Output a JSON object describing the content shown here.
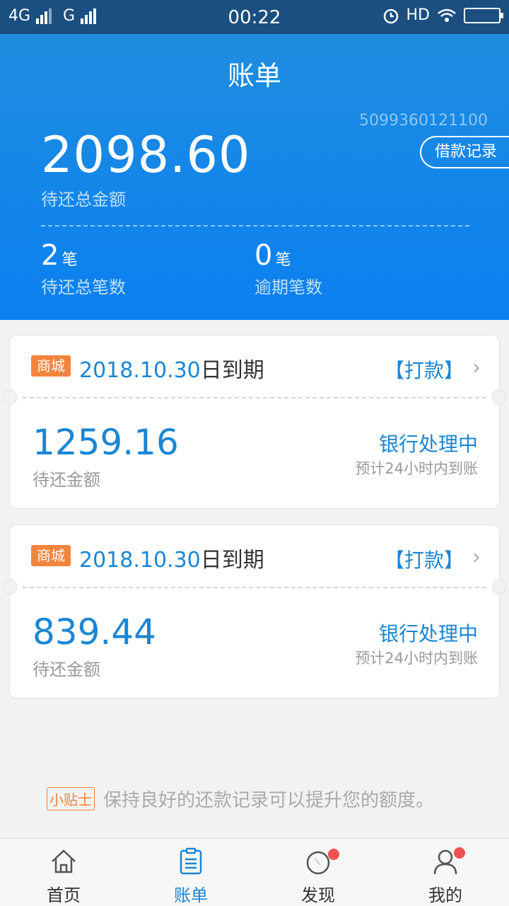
{
  "status_bar": {
    "net1": "4G",
    "net2": "G",
    "time": "00:22",
    "hd": "HD"
  },
  "header": {
    "title": "账单",
    "account_no": "5099360121100",
    "loan_record_label": "借款记录",
    "total_amount": "2098.60",
    "total_label": "待还总金额",
    "pending_count": "2",
    "pending_unit": "笔",
    "pending_label": "待还总笔数",
    "overdue_count": "0",
    "overdue_unit": "笔",
    "overdue_label": "逾期笔数"
  },
  "bills": [
    {
      "tag": "商城",
      "due_date": "2018.10.30",
      "due_suffix": "日到期",
      "action": "【打款】",
      "amount": "1259.16",
      "amount_label": "待还金额",
      "status": "银行处理中",
      "status_note": "预计24小时内到账"
    },
    {
      "tag": "商城",
      "due_date": "2018.10.30",
      "due_suffix": "日到期",
      "action": "【打款】",
      "amount": "839.44",
      "amount_label": "待还金额",
      "status": "银行处理中",
      "status_note": "预计24小时内到账"
    }
  ],
  "tip": {
    "tag": "小贴士",
    "text": "保持良好的还款记录可以提升您的额度。"
  },
  "tabs": [
    {
      "label": "首页",
      "icon": "home-icon",
      "active": false,
      "badge": false
    },
    {
      "label": "账单",
      "icon": "bill-icon",
      "active": true,
      "badge": false
    },
    {
      "label": "发现",
      "icon": "compass-icon",
      "active": false,
      "badge": true
    },
    {
      "label": "我的",
      "icon": "user-icon",
      "active": false,
      "badge": true
    }
  ],
  "colors": {
    "primary": "#1a86d4",
    "header_bg": "#0a80f0",
    "tag_orange": "#f3843d",
    "badge_red": "#f05252"
  }
}
